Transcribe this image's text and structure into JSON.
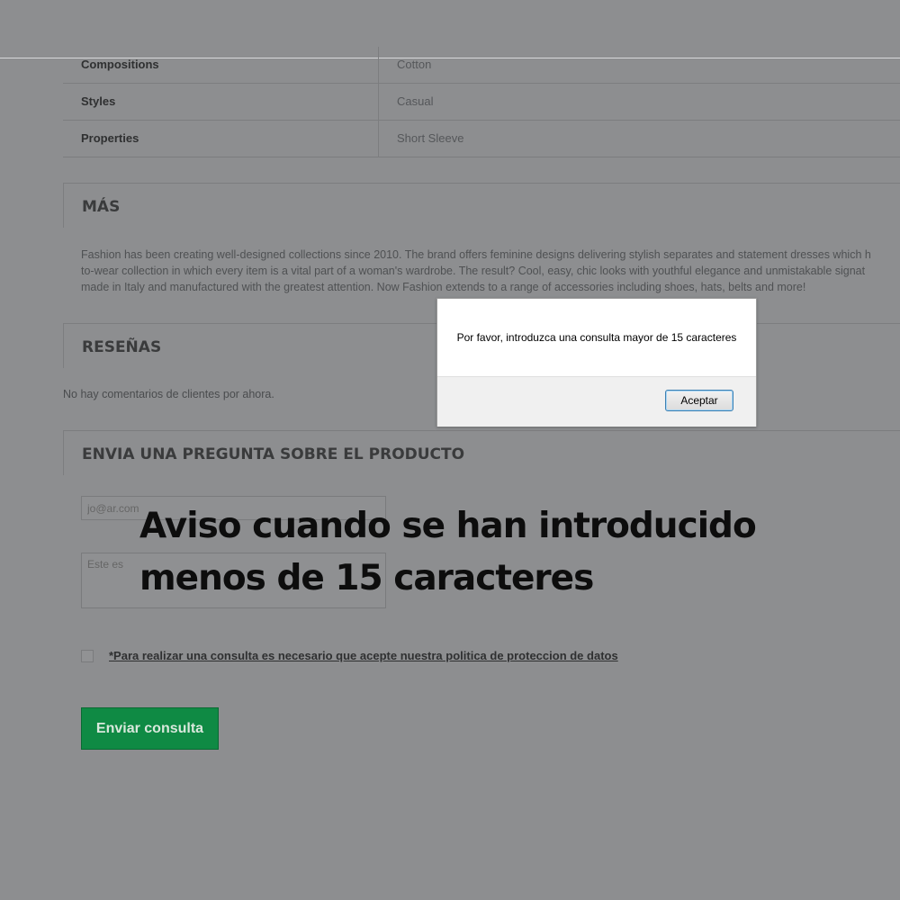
{
  "specs": [
    {
      "label": "Compositions",
      "value": "Cotton"
    },
    {
      "label": "Styles",
      "value": "Casual"
    },
    {
      "label": "Properties",
      "value": "Short Sleeve"
    }
  ],
  "sections": {
    "more_title": "MÁS",
    "reviews_title": "RESEÑAS",
    "question_title": "ENVIA UNA PREGUNTA SOBRE EL PRODUCTO"
  },
  "description_lines": [
    "Fashion has been creating well-designed collections since 2010. The brand offers feminine designs delivering stylish separates and statement dresses which h",
    "to-wear collection in which every item is a vital part of a woman's wardrobe. The result? Cool, easy, chic looks with youthful elegance and unmistakable signat",
    "made in Italy and manufactured with the greatest attention. Now Fashion extends to a range of accessories including shoes, hats, belts and more!"
  ],
  "reviews": {
    "empty_text": "No hay comentarios de clientes por ahora."
  },
  "form": {
    "email_value": "jo@ar.com",
    "question_value": "Este es",
    "policy_text": "*Para realizar una consulta es necesario que acepte nuestra politica de proteccion de datos",
    "submit_label": "Enviar consulta"
  },
  "caption": {
    "line1": "Aviso cuando se han introducido",
    "line2": "menos de 15 caracteres"
  },
  "dialog": {
    "message": "Por favor, introduzca una consulta mayor de 15 caracteres",
    "ok_label": "Aceptar"
  },
  "colors": {
    "dimmed_background": "#8d8e90",
    "submit_green": "#0f8a44"
  }
}
